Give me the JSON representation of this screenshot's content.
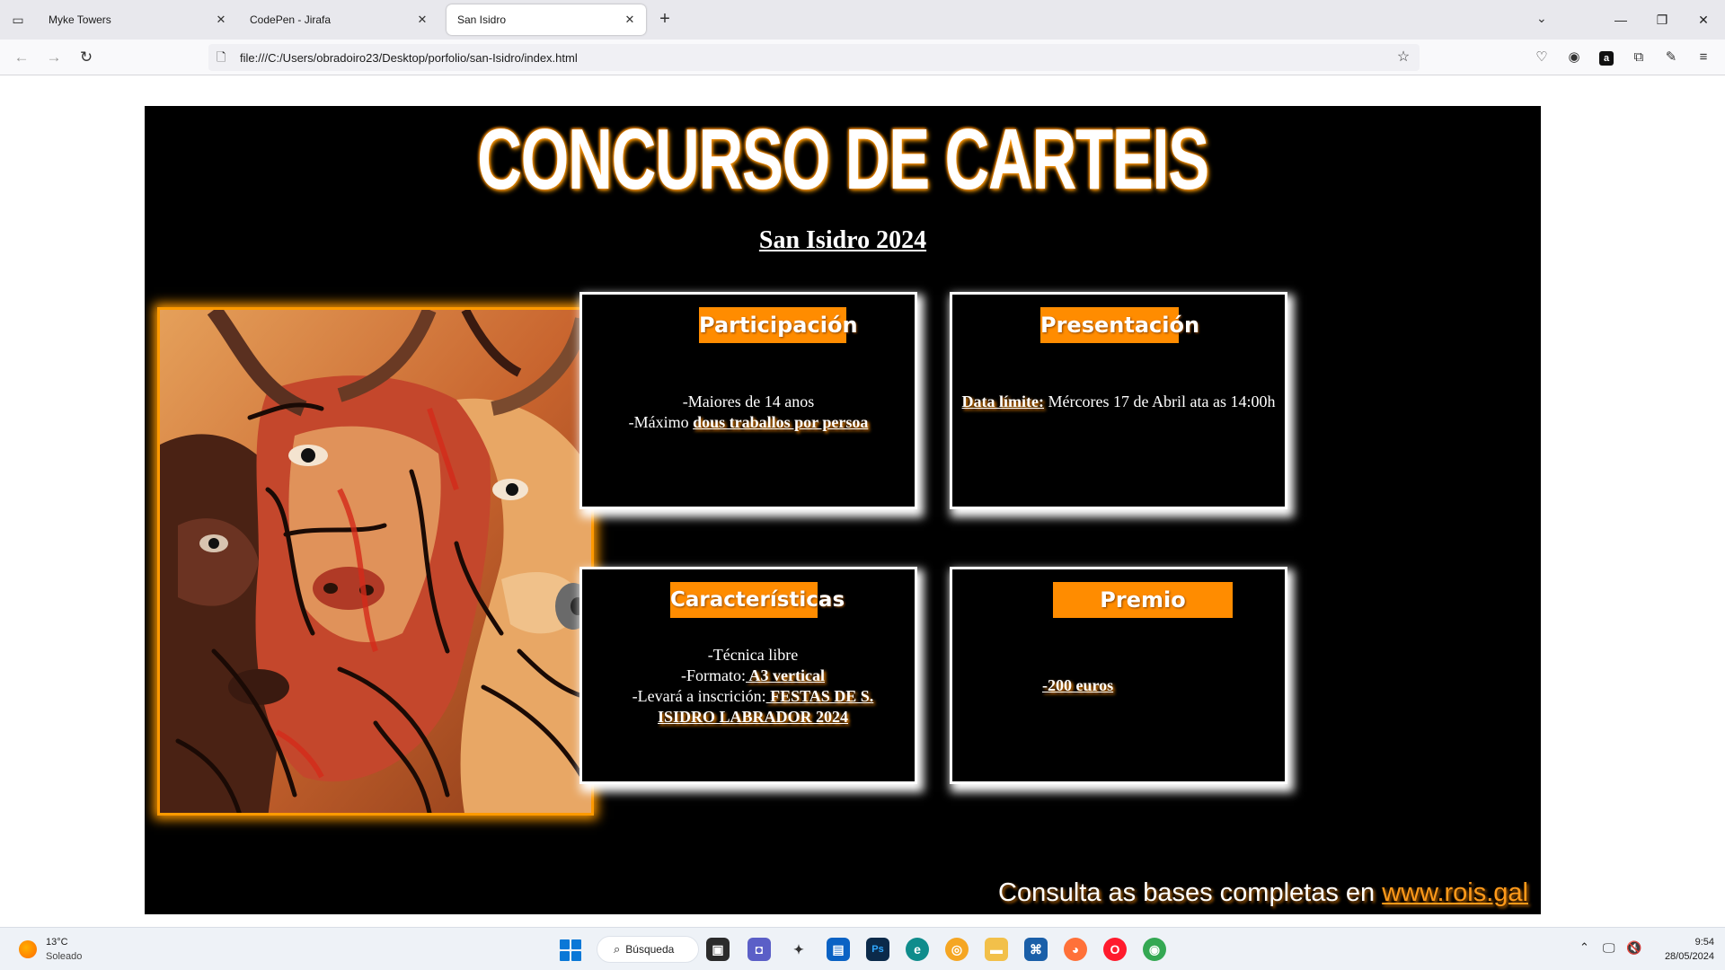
{
  "browser": {
    "tabs": [
      {
        "label": "Myke Towers",
        "active": false
      },
      {
        "label": "CodePen - Jirafa",
        "active": false
      },
      {
        "label": "San Isidro",
        "active": true
      }
    ],
    "url": "file:///C:/Users/obradoiro23/Desktop/porfolio/san-Isidro/index.html"
  },
  "page": {
    "title": "CONCURSO DE CARTEIS",
    "subtitle": "San Isidro 2024",
    "cards": {
      "participacion": {
        "heading": "Participación",
        "line1": "-Maiores de 14 anos",
        "line2_prefix": "-Máximo ",
        "line2_highlight": "dous traballos por persoa"
      },
      "presentacion": {
        "heading": "Presentación",
        "highlight": "Data límite:",
        "text": " Mércores 17 de Abril ata as 14:00h"
      },
      "caracteristicas": {
        "heading": "Características",
        "line1": "-Técnica libre",
        "line2_prefix": "-Formato:",
        "line2_highlight": " A3 vertical",
        "line3_prefix": "-Levará a inscrición:",
        "line3_highlight": " FESTAS DE S. ISIDRO LABRADOR 2024"
      },
      "premio": {
        "heading": "Premio",
        "highlight": "-200 euros"
      }
    },
    "footer": {
      "text": "Consulta as bases completas en ",
      "link": "www.rois.gal"
    },
    "colors": {
      "accent": "#ff8c00",
      "background": "#000000",
      "text": "#ffffff"
    }
  },
  "taskbar": {
    "weather_temp": "13°C",
    "weather_condition": "Soleado",
    "search_label": "Búsqueda",
    "time": "9:54",
    "date": "28/05/2024"
  }
}
